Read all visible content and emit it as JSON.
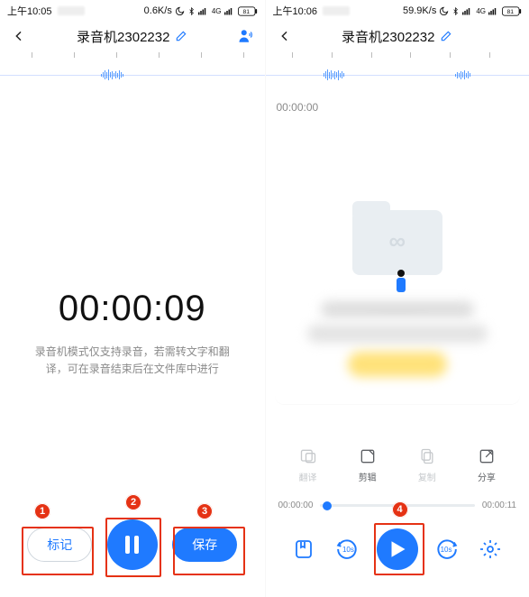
{
  "left": {
    "status": {
      "time": "上午10:05",
      "net": "0.6K/s",
      "battery": "81"
    },
    "header": {
      "title": "录音机2302232"
    },
    "timer": "00:00:09",
    "hint_l1": "录音机模式仅支持录音，若需转文字和翻",
    "hint_l2": "译，可在录音结束后在文件库中进行",
    "buttons": {
      "mark": "标记",
      "save": "保存"
    },
    "badges": {
      "b1": "1",
      "b2": "2",
      "b3": "3"
    }
  },
  "right": {
    "status": {
      "time": "上午10:06",
      "net": "59.9K/s",
      "battery": "81"
    },
    "header": {
      "title": "录音机2302232"
    },
    "timecode": "00:00:00",
    "tools": {
      "t1": "翻译",
      "t2": "剪辑",
      "t3": "复制",
      "t4": "分享"
    },
    "progress": {
      "start": "00:00:00",
      "end": "00:00:11"
    },
    "seek_label": "10s",
    "badges": {
      "b4": "4"
    }
  }
}
